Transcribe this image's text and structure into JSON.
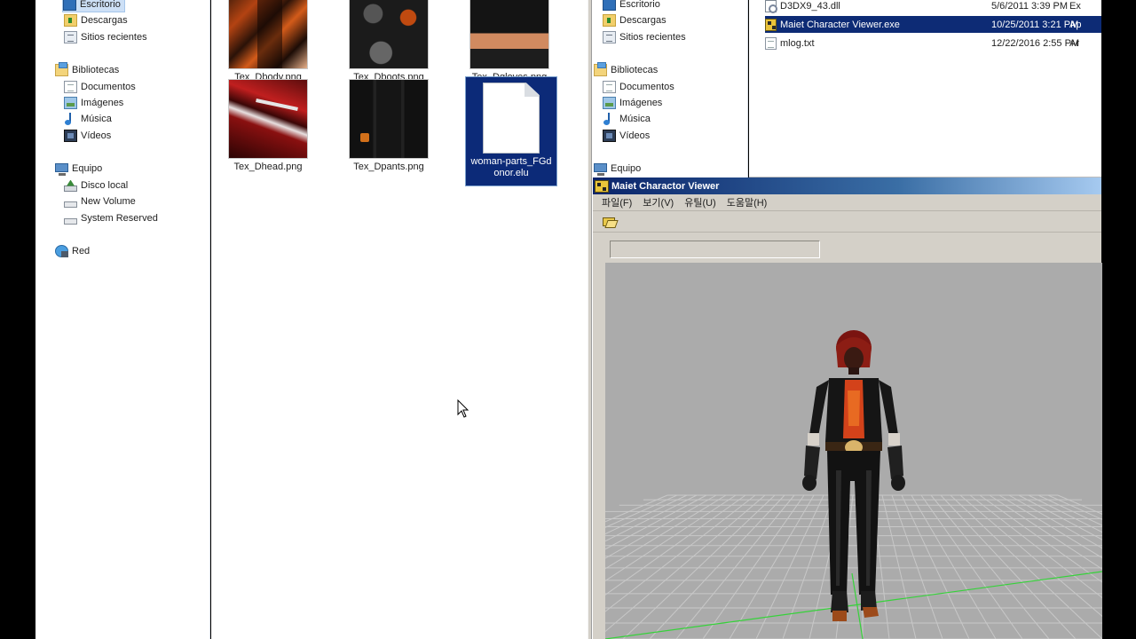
{
  "left_nav": {
    "favorites": [
      {
        "label": "Escritorio",
        "icon": "desktop-icon",
        "selected": true
      },
      {
        "label": "Descargas",
        "icon": "downloads-icon"
      },
      {
        "label": "Sitios recientes",
        "icon": "recent-places-icon"
      }
    ],
    "libraries_label": "Bibliotecas",
    "libraries": [
      {
        "label": "Documentos",
        "icon": "documents-icon"
      },
      {
        "label": "Imágenes",
        "icon": "pictures-icon"
      },
      {
        "label": "Música",
        "icon": "music-icon"
      },
      {
        "label": "Vídeos",
        "icon": "videos-icon"
      }
    ],
    "computer_label": "Equipo",
    "drives": [
      {
        "label": "Disco local",
        "icon": "local-disk-icon"
      },
      {
        "label": "New Volume",
        "icon": "drive-icon"
      },
      {
        "label": "System Reserved",
        "icon": "drive-icon"
      }
    ],
    "network_label": "Red"
  },
  "files_left": [
    {
      "name": "Tex_Dbody.png",
      "thumb": "body"
    },
    {
      "name": "Tex_Dboots.png",
      "thumb": "boots"
    },
    {
      "name": "Tex_Dgloves.png",
      "thumb": "gloves"
    },
    {
      "name": "Tex_Dhead.png",
      "thumb": "head"
    },
    {
      "name": "Tex_Dpants.png",
      "thumb": "pants"
    },
    {
      "name": "woman-parts_FGdonor.elu",
      "thumb": "generic-file",
      "selected": true
    }
  ],
  "right_nav": {
    "favorites": [
      {
        "label": "Escritorio",
        "icon": "desktop-icon"
      },
      {
        "label": "Descargas",
        "icon": "downloads-icon"
      },
      {
        "label": "Sitios recientes",
        "icon": "recent-places-icon"
      }
    ],
    "libraries_label": "Bibliotecas",
    "libraries": [
      {
        "label": "Documentos",
        "icon": "documents-icon"
      },
      {
        "label": "Imágenes",
        "icon": "pictures-icon"
      },
      {
        "label": "Música",
        "icon": "music-icon"
      },
      {
        "label": "Vídeos",
        "icon": "videos-icon"
      }
    ],
    "computer_label": "Equipo"
  },
  "files_right": [
    {
      "name": "D3DX9_43.dll",
      "date": "5/6/2011 3:39 PM",
      "type": "Ex",
      "icon": "dll-icon"
    },
    {
      "name": "Maiet Character Viewer.exe",
      "date": "10/25/2011 3:21 PM",
      "type": "Ap",
      "icon": "exe-icon",
      "selected": true
    },
    {
      "name": "mlog.txt",
      "date": "12/22/2016 2:55 PM",
      "type": "Ar",
      "icon": "text-file-icon"
    }
  ],
  "viewer": {
    "title": "Maiet Charactor Viewer",
    "menu": [
      "파일(F)",
      "보기(V)",
      "유틸(U)",
      "도움말(H)"
    ],
    "toolbar": [
      {
        "icon": "open-folder-icon"
      }
    ],
    "status_text": ""
  },
  "colors": {
    "selection_dark": "#0d2b75",
    "selection_light": "#cde0f6",
    "title_bar": "#0a246a",
    "viewport_bg": "#ababab",
    "grid_line": "#c8c8c8",
    "axis_green": "#36d23a"
  }
}
